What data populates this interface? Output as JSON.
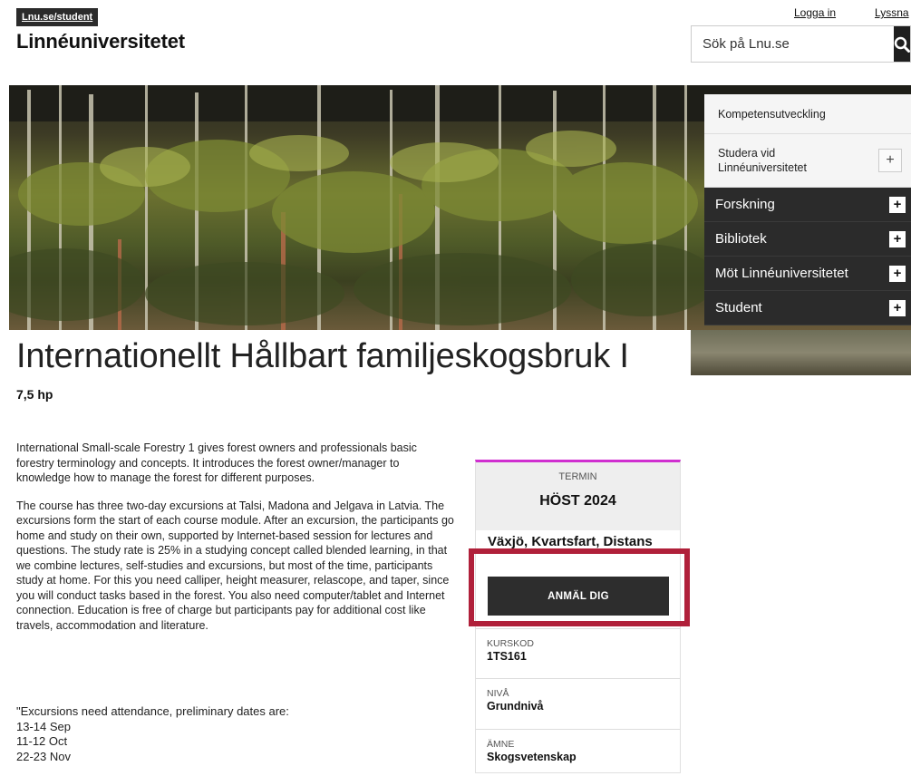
{
  "header": {
    "breadcrumb": "Lnu.se/student",
    "logo": "Linnéuniversitetet",
    "login": "Logga in",
    "listen": "Lyssna",
    "search_placeholder": "Sök på Lnu.se"
  },
  "nav": {
    "light_items": [
      {
        "label": "Kompetensutveckling"
      },
      {
        "label": "Studera vid Linnéuniversitetet",
        "expand": "+"
      }
    ],
    "dark_items": [
      {
        "label": "Forskning",
        "expand": "+"
      },
      {
        "label": "Bibliotek",
        "expand": "+"
      },
      {
        "label": "Möt Linnéuniversitetet",
        "expand": "+"
      },
      {
        "label": "Student",
        "expand": "+"
      }
    ]
  },
  "course": {
    "title": "Internationellt Hållbart familjeskogsbruk I",
    "credits": "7,5 hp",
    "paragraphs": [
      "International Small-scale Forestry 1 gives forest owners and professionals basic forestry terminology and concepts. It introduces the forest owner/manager to knowledge how to manage the forest for different purposes.",
      "The course has three two-day excursions at Talsi, Madona and Jelgava in Latvia. The excursions form the start of each course module. After an excursion, the participants go home and study on their own, supported by Internet-based session for lectures and questions. The study rate is 25% in a studying concept called blended learning, in that we combine lectures, self-studies and excursions, but most of the time, participants study at home. For this you need calliper, height measurer, relascope, and taper, since you will conduct tasks based in the forest. You also need computer/tablet and Internet connection. Education is free of charge but participants pay for additional cost like travels, accommodation and literature.",
      "\"Excursions need attendance, preliminary dates are:"
    ],
    "dates": [
      "13-14 Sep",
      "11-12 Oct",
      "22-23 Nov"
    ]
  },
  "card": {
    "term_label": "TERMIN",
    "term_value": "HÖST 2024",
    "location": "Växjö, Kvartsfart, Distans",
    "apply_label": "ANMÄL DIG",
    "facts": [
      {
        "label": "KURSKOD",
        "value": "1TS161"
      },
      {
        "label": "NIVÅ",
        "value": "Grundnivå"
      },
      {
        "label": "ÄMNE",
        "value": "Skogsvetenskap"
      }
    ],
    "accent_color": "#d02fd0",
    "highlight_color": "#b0203a"
  }
}
